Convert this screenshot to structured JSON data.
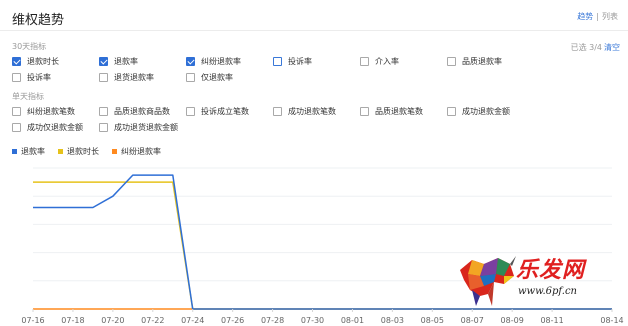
{
  "header": {
    "title": "维权趋势",
    "view_trend": "趋势",
    "separator": "|",
    "view_list": "列表"
  },
  "metrics30": {
    "label": "30天指标",
    "selected_text": "已选 3/4",
    "clear_label": "清空",
    "items": [
      {
        "label": "退款时长",
        "checked": true
      },
      {
        "label": "退款率",
        "checked": true
      },
      {
        "label": "纠纷退款率",
        "checked": true
      },
      {
        "label": "投诉率",
        "checked": false
      },
      {
        "label": "介入率",
        "checked": false
      },
      {
        "label": "品质退款率",
        "checked": false
      },
      {
        "label": "投诉率",
        "checked": false
      },
      {
        "label": "退货退款率",
        "checked": false
      },
      {
        "label": "仅退款率",
        "checked": false
      }
    ]
  },
  "metricsDay": {
    "label": "单天指标",
    "items": [
      {
        "label": "纠纷退款笔数"
      },
      {
        "label": "品质退款商品数"
      },
      {
        "label": "投诉成立笔数"
      },
      {
        "label": "成功退款笔数"
      },
      {
        "label": "品质退款笔数"
      },
      {
        "label": "成功退款金额"
      },
      {
        "label": "成功仅退款金额"
      },
      {
        "label": "成功退货退款金额"
      }
    ]
  },
  "chart_data": {
    "type": "line",
    "x": [
      "07-16",
      "07-17",
      "07-18",
      "07-19",
      "07-20",
      "07-21",
      "07-22",
      "07-23",
      "07-24",
      "07-25",
      "07-26",
      "07-27",
      "07-28",
      "07-29",
      "07-30",
      "07-31",
      "08-01",
      "08-02",
      "08-03",
      "08-04",
      "08-05",
      "08-06",
      "08-07",
      "08-08",
      "08-09",
      "08-10",
      "08-11",
      "08-12",
      "08-13",
      "08-14"
    ],
    "tick_labels": [
      "07-16",
      "07-18",
      "07-20",
      "07-22",
      "07-24",
      "07-26",
      "07-28",
      "07-30",
      "08-01",
      "08-03",
      "08-05",
      "08-07",
      "08-09",
      "08-11",
      "08-14"
    ],
    "ylim": [
      0,
      100
    ],
    "grid": true,
    "legend_position": "top-left",
    "series": [
      {
        "name": "退款率",
        "color": "#2f6fd6",
        "values": [
          72,
          72,
          72,
          72,
          80,
          95,
          95,
          95,
          0,
          0,
          0,
          0,
          0,
          0,
          0,
          0,
          0,
          0,
          0,
          0,
          0,
          0,
          0,
          0,
          0,
          0,
          0,
          0,
          0,
          0
        ]
      },
      {
        "name": "退款时长",
        "color": "#e6c21b",
        "values": [
          90,
          90,
          90,
          90,
          90,
          90,
          90,
          90,
          0,
          0,
          0,
          0,
          0,
          0,
          0,
          0,
          0,
          0,
          0,
          0,
          0,
          0,
          0,
          0,
          0,
          0,
          0,
          0,
          0,
          0
        ]
      },
      {
        "name": "纠纷退款率",
        "color": "#ff8a1f",
        "values": [
          0,
          0,
          0,
          0,
          0,
          0,
          0,
          0,
          0,
          0,
          0,
          0,
          0,
          0,
          0,
          0,
          0,
          0,
          0,
          0,
          0,
          0,
          0,
          0,
          0,
          0,
          0,
          0,
          0,
          0
        ]
      }
    ]
  },
  "watermark": {
    "brand": "乐发网",
    "url": "www.6pf.cn"
  }
}
